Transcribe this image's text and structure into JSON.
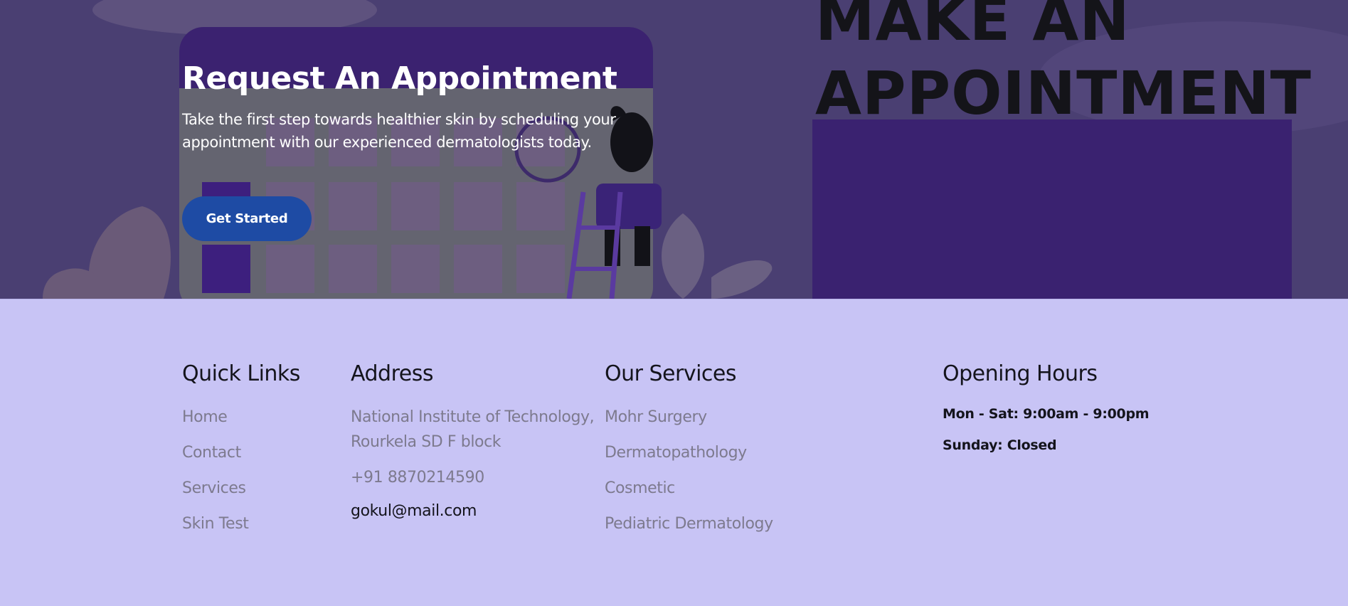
{
  "hero": {
    "title": "Request An Appointment",
    "subtitle": "Take the first step towards healthier skin by scheduling your appointment with our experienced dermatologists today.",
    "cta_label": "Get Started",
    "image_text_line1": "MAKE AN",
    "image_text_line2": "APPOINTMENT"
  },
  "footer": {
    "quick_links": {
      "heading": "Quick Links",
      "items": [
        "Home",
        "Contact",
        "Services",
        "Skin Test"
      ]
    },
    "address": {
      "heading": "Address",
      "line1": "National Institute of Technology, Rourkela SD F block",
      "phone": "+91 8870214590",
      "email": "gokul@mail.com"
    },
    "services": {
      "heading": "Our Services",
      "items": [
        "Mohr Surgery",
        "Dermatopathology",
        "Cosmetic",
        "Pediatric Dermatology"
      ]
    },
    "hours": {
      "heading": "Opening Hours",
      "weekday": "Mon - Sat: 9:00am - 9:00pm",
      "sunday": "Sunday: Closed"
    }
  },
  "colors": {
    "hero_overlay": "#4a3f72",
    "cta": "#1e4ba4",
    "footer_bg": "#c8c4f5",
    "link_gray": "#7d7a8e",
    "heading": "#14141c"
  }
}
